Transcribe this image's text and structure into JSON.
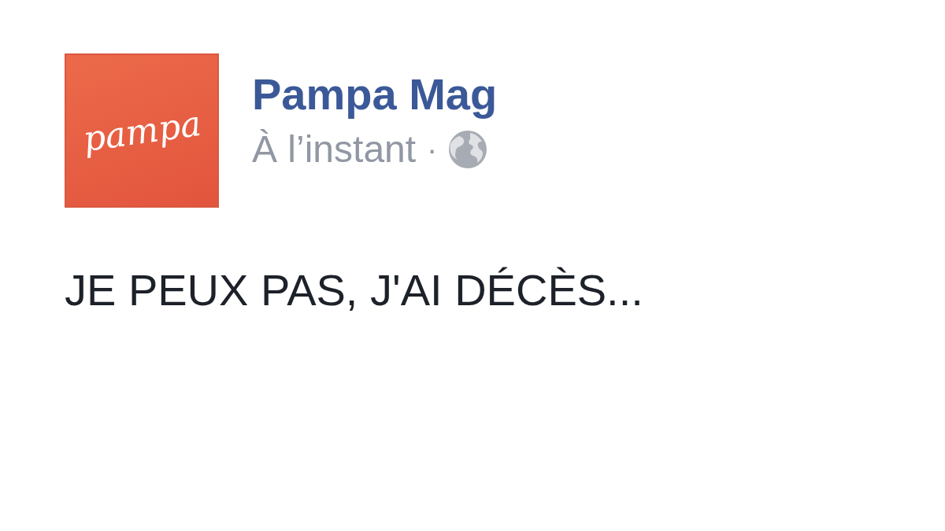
{
  "post": {
    "avatar": {
      "logo_text": "pampa"
    },
    "author": "Pampa Mag",
    "time": "À l’instant",
    "separator": "·",
    "text": "JE PEUX PAS, J'AI DÉCÈS..."
  }
}
